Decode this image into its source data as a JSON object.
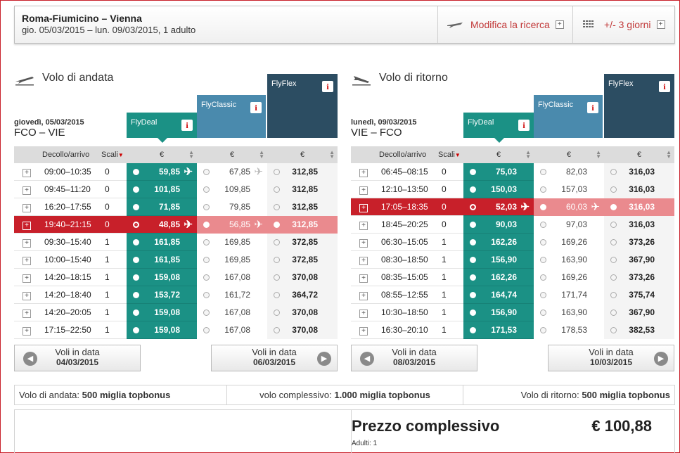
{
  "header": {
    "route": "Roma-Fiumicino – Vienna",
    "dates": "gio. 05/03/2015 – lun. 09/03/2015, 1 adulto",
    "modify_label": "Modifica la ricerca",
    "days_label": "+/- 3 giorni",
    "plus": "+"
  },
  "outbound": {
    "title": "Volo di andata",
    "date": "giovedì, 05/03/2015",
    "route": "FCO – VIE",
    "fares": {
      "deal": "FlyDeal",
      "classic": "FlyClassic",
      "flex": "FlyFlex",
      "info": "i"
    },
    "columns": {
      "time": "Decollo/arrivo",
      "stops": "Scali",
      "currency": "€"
    },
    "rows": [
      {
        "time": "09:00–10:35",
        "stops": "0",
        "deal": "59,85",
        "classic": "67,85",
        "flex": "312,85"
      },
      {
        "time": "09:45–11:20",
        "stops": "0",
        "deal": "101,85",
        "classic": "109,85",
        "flex": "312,85"
      },
      {
        "time": "16:20–17:55",
        "stops": "0",
        "deal": "71,85",
        "classic": "79,85",
        "flex": "312,85"
      },
      {
        "time": "19:40–21:15",
        "stops": "0",
        "deal": "48,85",
        "classic": "56,85",
        "flex": "312,85"
      },
      {
        "time": "09:30–15:40",
        "stops": "1",
        "deal": "161,85",
        "classic": "169,85",
        "flex": "372,85"
      },
      {
        "time": "10:00–15:40",
        "stops": "1",
        "deal": "161,85",
        "classic": "169,85",
        "flex": "372,85"
      },
      {
        "time": "14:20–18:15",
        "stops": "1",
        "deal": "159,08",
        "classic": "167,08",
        "flex": "370,08"
      },
      {
        "time": "14:20–18:40",
        "stops": "1",
        "deal": "153,72",
        "classic": "161,72",
        "flex": "364,72"
      },
      {
        "time": "14:20–20:05",
        "stops": "1",
        "deal": "159,08",
        "classic": "167,08",
        "flex": "370,08"
      },
      {
        "time": "17:15–22:50",
        "stops": "1",
        "deal": "159,08",
        "classic": "167,08",
        "flex": "370,08"
      }
    ],
    "prev": {
      "label": "Voli in data",
      "date": "04/03/2015"
    },
    "next": {
      "label": "Voli in data",
      "date": "06/03/2015"
    }
  },
  "inbound": {
    "title": "Volo di ritorno",
    "date": "lunedì, 09/03/2015",
    "route": "VIE – FCO",
    "fares": {
      "deal": "FlyDeal",
      "classic": "FlyClassic",
      "flex": "FlyFlex",
      "info": "i"
    },
    "columns": {
      "time": "Decollo/arrivo",
      "stops": "Scali",
      "currency": "€"
    },
    "rows": [
      {
        "time": "06:45–08:15",
        "stops": "0",
        "deal": "75,03",
        "classic": "82,03",
        "flex": "316,03"
      },
      {
        "time": "12:10–13:50",
        "stops": "0",
        "deal": "150,03",
        "classic": "157,03",
        "flex": "316,03"
      },
      {
        "time": "17:05–18:35",
        "stops": "0",
        "deal": "52,03",
        "classic": "60,03",
        "flex": "316,03"
      },
      {
        "time": "18:45–20:25",
        "stops": "0",
        "deal": "90,03",
        "classic": "97,03",
        "flex": "316,03"
      },
      {
        "time": "06:30–15:05",
        "stops": "1",
        "deal": "162,26",
        "classic": "169,26",
        "flex": "373,26"
      },
      {
        "time": "08:30–18:50",
        "stops": "1",
        "deal": "156,90",
        "classic": "163,90",
        "flex": "367,90"
      },
      {
        "time": "08:35–15:05",
        "stops": "1",
        "deal": "162,26",
        "classic": "169,26",
        "flex": "373,26"
      },
      {
        "time": "08:55–12:55",
        "stops": "1",
        "deal": "164,74",
        "classic": "171,74",
        "flex": "375,74"
      },
      {
        "time": "10:30–18:50",
        "stops": "1",
        "deal": "156,90",
        "classic": "163,90",
        "flex": "367,90"
      },
      {
        "time": "16:30–20:10",
        "stops": "1",
        "deal": "171,53",
        "classic": "178,53",
        "flex": "382,53"
      }
    ],
    "prev": {
      "label": "Voli in data",
      "date": "08/03/2015"
    },
    "next": {
      "label": "Voli in data",
      "date": "10/03/2015"
    }
  },
  "miles": {
    "out_label": "Volo di andata:",
    "out_value": "500 miglia topbonus",
    "total_label": "volo complessivo:",
    "total_value": "1.000 miglia topbonus",
    "ret_label": "Volo di ritorno:",
    "ret_value": "500 miglia topbonus"
  },
  "total": {
    "label": "Prezzo complessivo",
    "value": "€ 100,88",
    "adults": "Adulti: 1"
  },
  "colors": {
    "deal": "#1b9185",
    "classic": "#4a8aad",
    "flex": "#2c4d62",
    "selected": "#c8202a",
    "accent": "#c23a3a"
  }
}
